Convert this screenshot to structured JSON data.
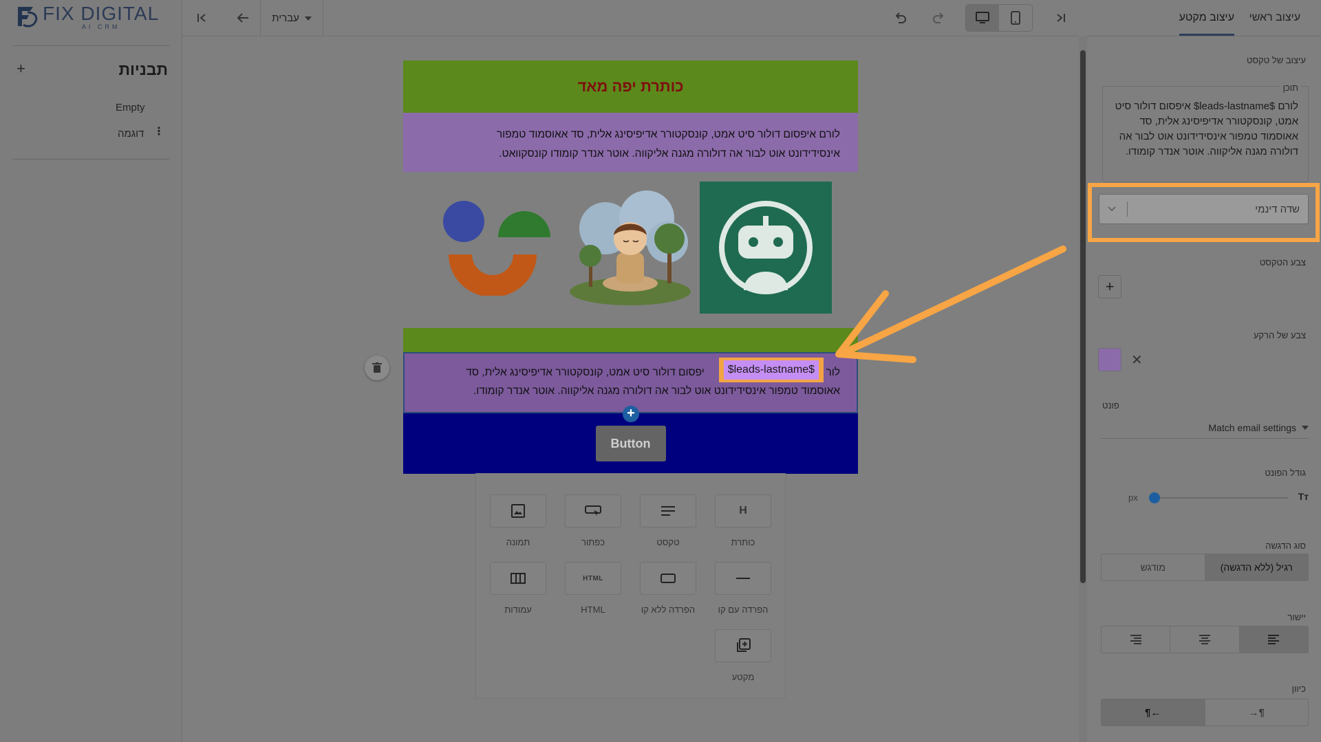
{
  "brand": {
    "name": "FIX DIGITAL",
    "sub": "AI CRM"
  },
  "sidebar": {
    "title": "תבניות",
    "items": [
      {
        "label": "Empty"
      },
      {
        "label": "דוגמה"
      }
    ]
  },
  "toolbar": {
    "language": "עברית"
  },
  "email": {
    "title": "כותרת יפה מאד",
    "paragraph_line1": "לורם איפסום דולור סיט אמט, קונסקטורר אדיפיסינג אלית, סד אאוסמוד טמפור",
    "paragraph_line2": "אינסידידונט אוט לבור אה דולורה מגנה אליקווה. אוטר אנדר קומודו קונסקוואט.",
    "selected_line1_start": "לור",
    "selected_line1_end": "יפסום דולור סיט אמט, קונסקטורר אדיפיסינג אלית, סד",
    "selected_line2": "אאוסמוד טמפור אינסידידונט אוט לבור אה דולורה מגנה אליקווה. אוטר אנדר קומודו.",
    "dynamic_tag": "$leads-lastname$",
    "button_label": "Button"
  },
  "palette": {
    "blocks": [
      {
        "label": "כותרת",
        "icon": "heading-icon"
      },
      {
        "label": "טקסט",
        "icon": "text-icon"
      },
      {
        "label": "כפתור",
        "icon": "button-icon"
      },
      {
        "label": "תמונה",
        "icon": "image-icon"
      },
      {
        "label": "הפרדה עם קו",
        "icon": "divider-line-icon"
      },
      {
        "label": "הפרדה ללא קו",
        "icon": "divider-no-line-icon"
      },
      {
        "label": "HTML",
        "icon": "html-icon"
      },
      {
        "label": "עמודות",
        "icon": "columns-icon"
      },
      {
        "label": "מקטע",
        "icon": "section-icon"
      }
    ]
  },
  "panel": {
    "tab_main": "עיצוב ראשי",
    "tab_section": "עיצוב מקטע",
    "text_design": "עיצוב של טקסט",
    "content_legend": "תוכן",
    "content_value": "לורם  $leads-lastname$ איפסום דולור סיט אמט, קונסקטורר אדיפיסינג אלית, סד אאוסמוד טמפור אינסידידונט אוט לבור אה דולורה מגנה אליקווה. אוטר אנדר קומודו.",
    "dynamic_field_placeholder": "שדה דינמי",
    "text_color": "צבע הטקסט",
    "bg_color": "צבע של הרקע",
    "font_label": "פונט",
    "font_value": "Match email settings",
    "font_size": "גודל הפונט",
    "font_size_unit": "px",
    "emphasis_label": "סוג הדגשה",
    "emphasis_normal": "רגיל (ללא הדגשה)",
    "emphasis_bold": "מודגש",
    "align_label": "יישור",
    "direction_label": "כיוון"
  },
  "colors": {
    "accent": "#f7a545",
    "title_bg": "#5b891b",
    "text_bg": "#8c6bab",
    "button_bg": "#00007e",
    "dynamic_tag_bg": "#c58ef4"
  }
}
